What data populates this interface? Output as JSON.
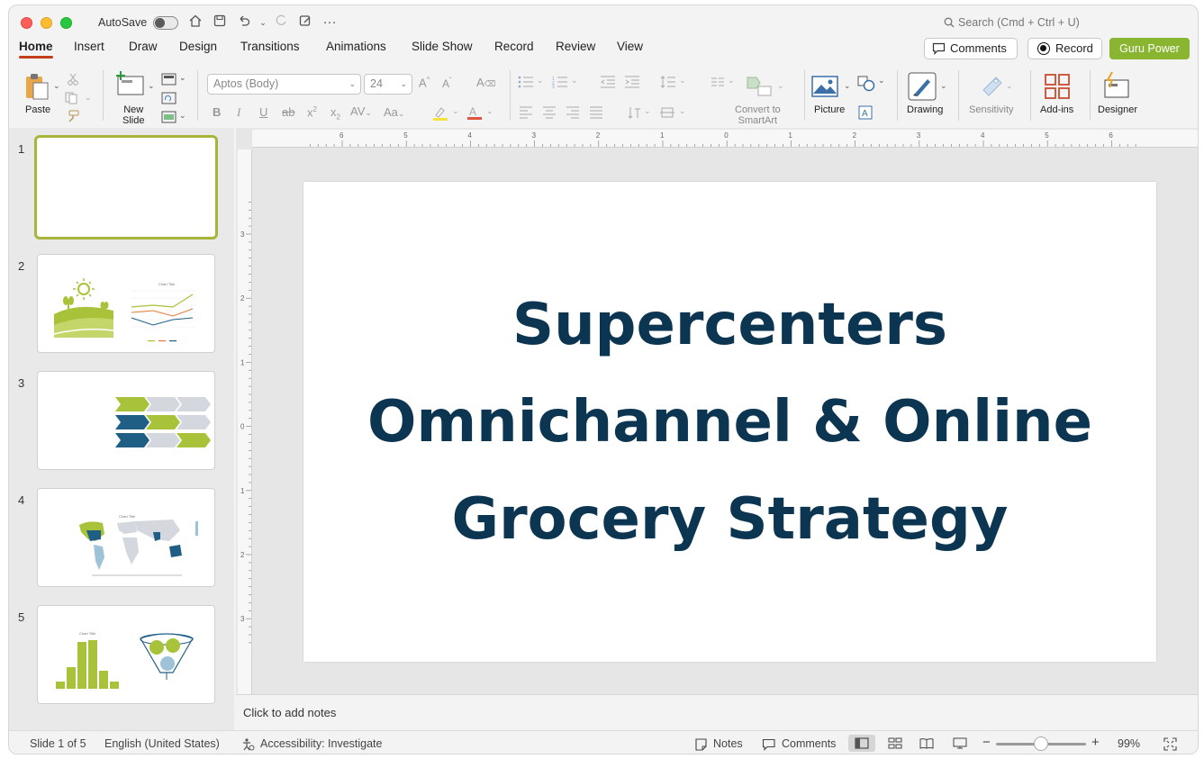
{
  "titlebar": {
    "autosave_label": "AutoSave",
    "search_placeholder": "Search (Cmd + Ctrl + U)"
  },
  "tabs": [
    "Home",
    "Insert",
    "Draw",
    "Design",
    "Transitions",
    "Animations",
    "Slide Show",
    "Record",
    "Review",
    "View"
  ],
  "header_buttons": {
    "comments": "Comments",
    "record": "Record",
    "guru": "Guru Power"
  },
  "ribbon": {
    "paste": "Paste",
    "new_slide": "New\nSlide",
    "font_name": "Aptos (Body)",
    "font_size": "24",
    "convert_smartart": "Convert to\nSmartArt",
    "picture": "Picture",
    "drawing": "Drawing",
    "sensitivity": "Sensitivity",
    "addins": "Add-ins",
    "designer": "Designer"
  },
  "slides": [
    "1",
    "2",
    "3",
    "4",
    "5"
  ],
  "slide": {
    "title_lines": [
      "Supercenters",
      "Omnichannel & Online",
      "Grocery Strategy"
    ]
  },
  "notes_placeholder": "Click to add notes",
  "status": {
    "slide_count": "Slide 1 of 5",
    "language": "English (United States)",
    "accessibility": "Accessibility: Investigate",
    "notes": "Notes",
    "comments": "Comments",
    "zoom": "99%"
  },
  "ruler": {
    "h_ticks": [
      "6",
      "5",
      "4",
      "3",
      "2",
      "1",
      "0",
      "1",
      "2",
      "3",
      "4",
      "5",
      "6"
    ],
    "v_ticks": [
      "3",
      "2",
      "1",
      "0",
      "1",
      "2",
      "3"
    ]
  },
  "colors": {
    "accent_tab": "#c43e1c",
    "guru_button": "#8ab531",
    "title_text": "#0b3551",
    "thumb_green": "#a8c23a",
    "thumb_blue": "#1f5f86"
  }
}
